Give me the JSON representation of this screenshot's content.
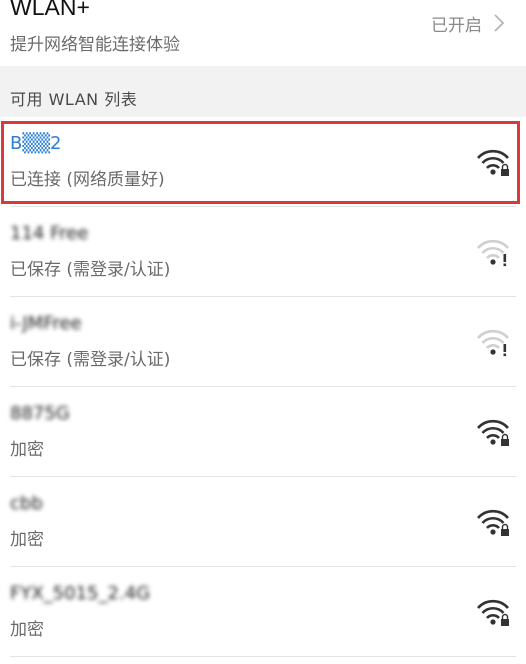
{
  "wlan_plus": {
    "title": "WLAN+",
    "subtitle": "提升网络智能连接体验",
    "status": "已开启"
  },
  "available_list": {
    "title": "可用 WLAN 列表"
  },
  "networks": [
    {
      "name": "B▒▒2",
      "status": "已连接 (网络质量好)",
      "connected": true,
      "signal_icon": "wifi-locked-icon"
    },
    {
      "name": "114 Free",
      "status": "已保存 (需登录/认证)",
      "connected": false,
      "signal_icon": "wifi-warning-icon"
    },
    {
      "name": "i-JMFree",
      "status": "已保存 (需登录/认证)",
      "connected": false,
      "signal_icon": "wifi-warning-icon"
    },
    {
      "name": "8875G",
      "status": "加密",
      "connected": false,
      "signal_icon": "wifi-locked-icon"
    },
    {
      "name": "cbb",
      "status": "加密",
      "connected": false,
      "signal_icon": "wifi-locked-icon"
    },
    {
      "name": "FYX_5015_2.4G",
      "status": "加密",
      "connected": false,
      "signal_icon": "wifi-locked-icon"
    }
  ],
  "colors": {
    "connected": "#2b7fd6",
    "highlight": "#d63a3a",
    "section_bg": "#f2f2f2"
  }
}
